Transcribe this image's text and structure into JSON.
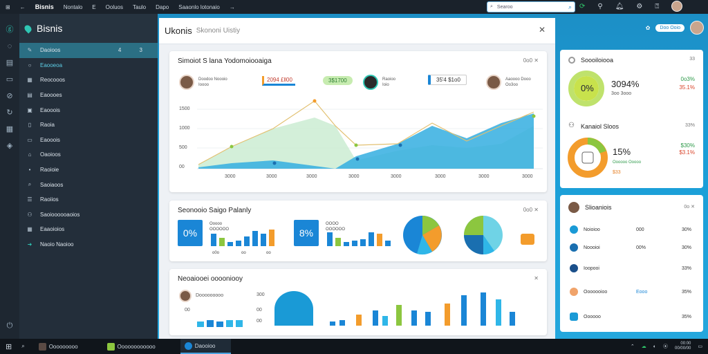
{
  "topbar": {
    "logo": "Bisnis",
    "menu": [
      "Nontalo",
      "E",
      "Ooluos",
      "Taulo",
      "Dapo",
      "Saaonlo lotonaio"
    ],
    "search_placeholder": "Searoo"
  },
  "sidebar": {
    "brand": "Bisnis",
    "items": [
      {
        "label": "Daoioos",
        "count": "4 3"
      },
      {
        "label": "Eaooeoa"
      },
      {
        "label": "Reocooos"
      },
      {
        "label": "Eaoooes"
      },
      {
        "label": "Eaooois"
      },
      {
        "label": "Raoia"
      },
      {
        "label": "Eaooois"
      },
      {
        "label": "Oaoioos"
      },
      {
        "label": "Raoioie"
      },
      {
        "label": "Saoiaoos"
      },
      {
        "label": "Raoiios"
      },
      {
        "label": "Saoioooooaoios"
      },
      {
        "label": "Eaaoioios"
      },
      {
        "label": "Naoio Naoioo"
      }
    ]
  },
  "main": {
    "title": "Ukonis",
    "subtitle": "Skononi Uistiy",
    "card1": {
      "title": "Simoiot S lana Yodomoiooaiga",
      "more": "0o0 ✕",
      "people": [
        {
          "name": "Doodoo Noooio",
          "role": "Ioooo"
        },
        {
          "name": "Raoioo",
          "role": "Ioio"
        },
        {
          "name": "Aaoooo Dooo",
          "role": "Oo3oo"
        }
      ],
      "tag_orange": "2094 £ll00",
      "tag_green": "3$1700",
      "tag_blue": "35'4 $1o0",
      "y_ticks": [
        "1500",
        "1000",
        "500",
        "00",
        "00"
      ],
      "x_ticks": [
        "3000",
        "3000",
        "3000",
        "3000",
        "3000",
        "3000",
        "3000",
        "3000"
      ]
    },
    "card2": {
      "title": "Seonooio Saigo Palanly",
      "more": "0o0 ✕",
      "kpi1": "0%",
      "kpi1_info": "Ooooo OOOOOO",
      "kpi2": "8%",
      "kpi2_info": "OOOO OOOOOO",
      "bar_labels": [
        "o0o",
        "oo",
        "oo"
      ]
    },
    "card3": {
      "title": "Neoaiooei ooooniooy",
      "person": "Dooooooooo",
      "y_ticks": [
        "300",
        "00",
        "00",
        "00"
      ],
      "more": "✕"
    }
  },
  "right": {
    "header_pill": "Doo Ooio",
    "card1": {
      "title": "Soooiloiooa",
      "count": "33",
      "ring_label": "0%",
      "stat": "3094%",
      "stat_sub": "3oo 3ooo",
      "v1": "0o3%",
      "v2": "35.1%"
    },
    "card2": {
      "title": "Kanaiol Sloos",
      "count": "33%",
      "stat": "15%",
      "stat_sub": "Oooooo Ooooo",
      "v1": "$30%",
      "v2": "$3.1%",
      "foot": "$33"
    },
    "card3": {
      "title": "Slioaniois",
      "rows": [
        {
          "a": "Noioioo",
          "b": "000",
          "c": "30%"
        },
        {
          "a": "Noooioi",
          "b": "00%",
          "c": "30%"
        },
        {
          "a": "Ioopooi",
          "b": "",
          "c": "33%"
        },
        {
          "a": "Ooooooioo",
          "b": "Eooo",
          "c": "35%"
        },
        {
          "a": "Oooooo",
          "b": "",
          "c": "35%"
        }
      ]
    }
  },
  "taskbar": {
    "items": [
      "Ooooooooo",
      "Oooooooooooo",
      "Daooioo"
    ],
    "time": "00:00",
    "date": "00/00/00"
  },
  "colors": {
    "accent": "#1a9ad6",
    "sidebar": "#232e3a",
    "green": "#8cc63f",
    "orange": "#f39c2c"
  }
}
